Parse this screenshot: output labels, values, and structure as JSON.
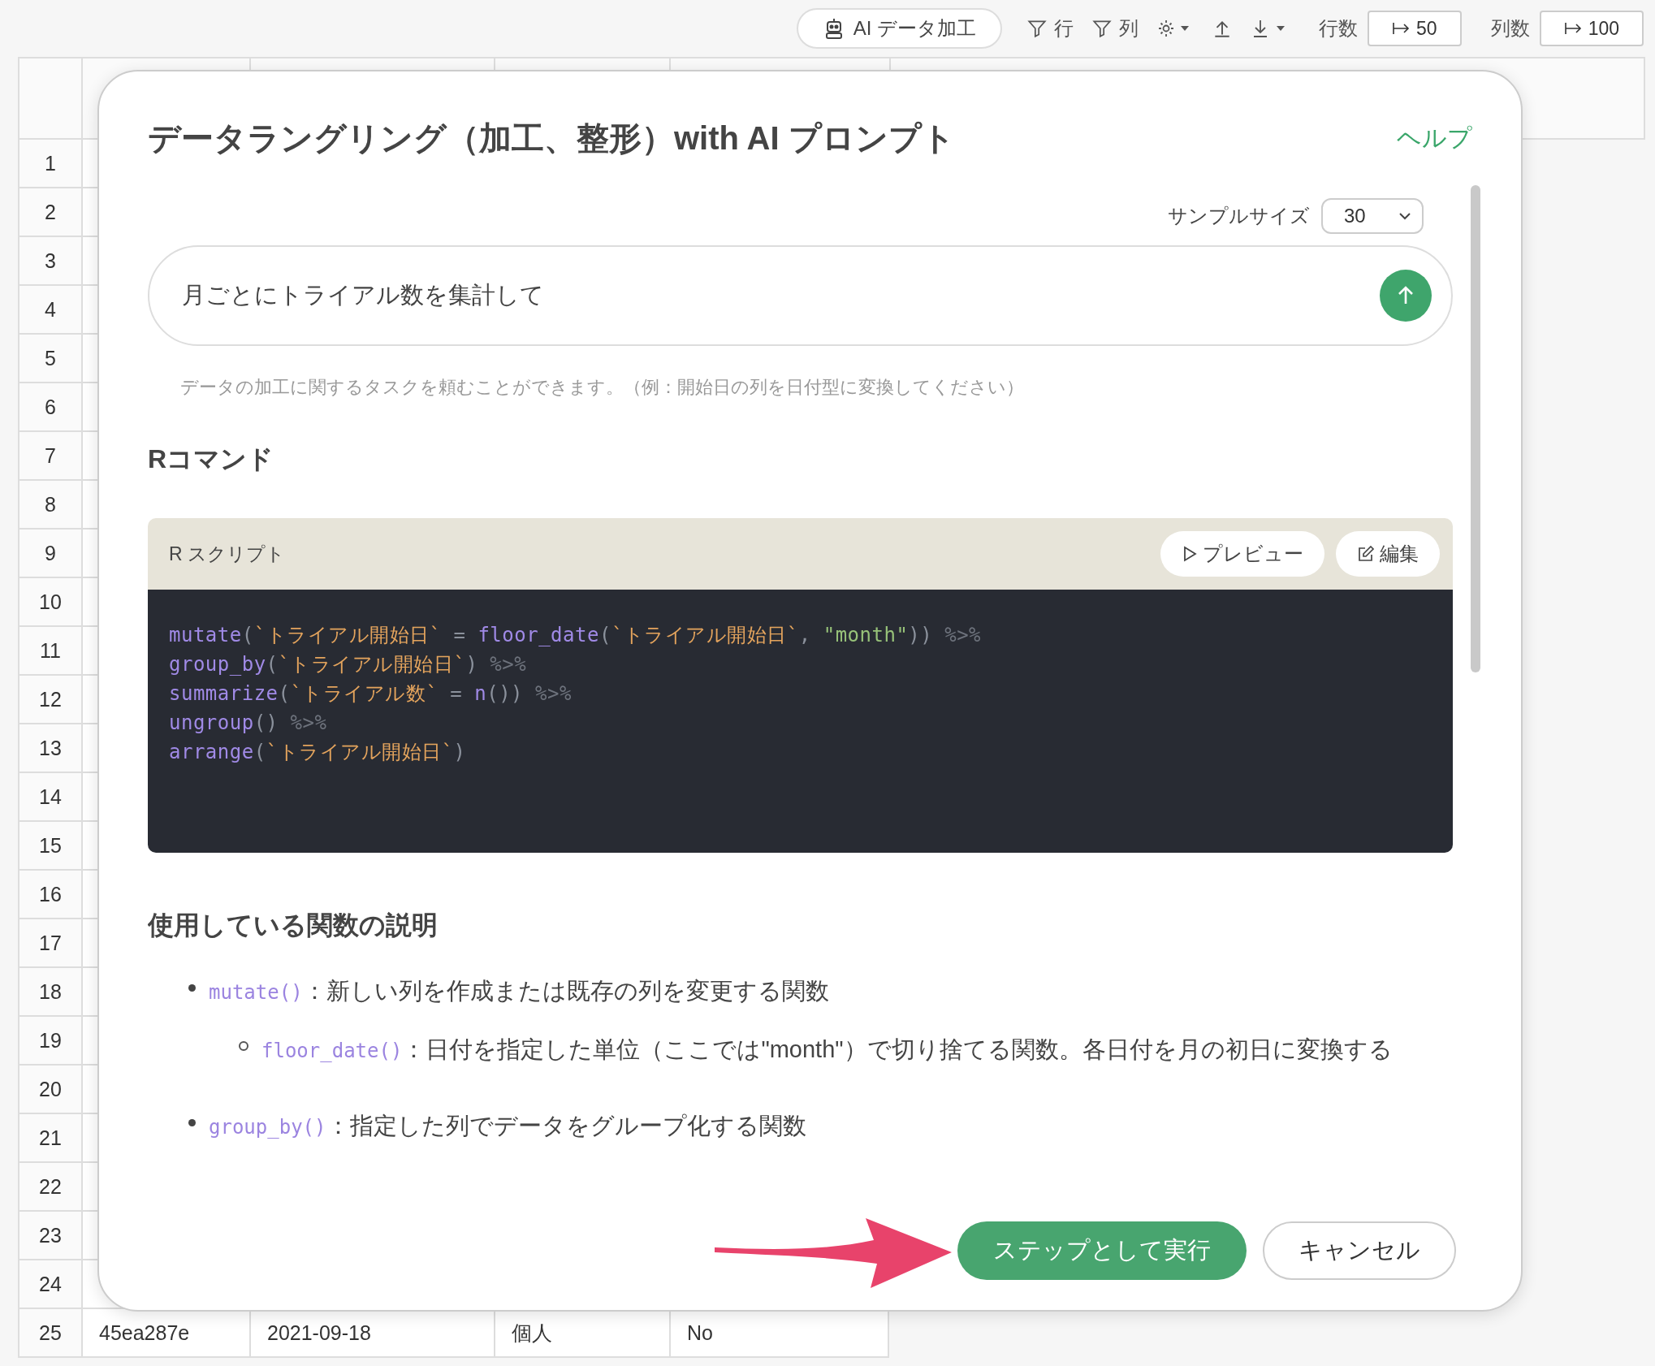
{
  "toolbar": {
    "ai_button": "AI データ加工",
    "row_filter": "行",
    "column_filter": "列",
    "row_count_label": "行数",
    "row_count": "50",
    "column_count_label": "列数",
    "column_count": "100"
  },
  "sheet": {
    "row_numbers": [
      "1",
      "2",
      "3",
      "4",
      "5",
      "6",
      "7",
      "8",
      "9",
      "10",
      "11",
      "12",
      "13",
      "14",
      "15",
      "16",
      "17",
      "18",
      "19",
      "20",
      "21",
      "22",
      "23",
      "24",
      "25"
    ],
    "last_row": [
      "45ea287e",
      "2021-09-18",
      "個人",
      "No"
    ]
  },
  "dialog": {
    "title": "データラングリング（加工、整形）with AI プロンプト",
    "help_link": "ヘルプ",
    "sample_size_label": "サンプルサイズ",
    "sample_size": "30",
    "prompt": "月ごとにトライアル数を集計して",
    "hint": "データの加工に関するタスクを頼むことができます。（例：開始日の列を日付型に変換してください）",
    "command_heading": "Rコマンド",
    "script_title": "R スクリプト",
    "preview_button": "プレビュー",
    "edit_button": "編集",
    "code_lines": [
      [
        {
          "kind": "fn",
          "text": "mutate"
        },
        {
          "kind": "punct",
          "text": "("
        },
        {
          "kind": "name",
          "text": "`トライアル開始日`"
        },
        {
          "kind": "punct",
          "text": " = "
        },
        {
          "kind": "fn",
          "text": "floor_date"
        },
        {
          "kind": "punct",
          "text": "("
        },
        {
          "kind": "name",
          "text": "`トライアル開始日`"
        },
        {
          "kind": "punct",
          "text": ", "
        },
        {
          "kind": "string",
          "text": "\"month\""
        },
        {
          "kind": "punct",
          "text": ")) "
        },
        {
          "kind": "pipe",
          "text": "%>%"
        }
      ],
      [
        {
          "kind": "fn",
          "text": "group_by"
        },
        {
          "kind": "punct",
          "text": "("
        },
        {
          "kind": "name",
          "text": "`トライアル開始日`"
        },
        {
          "kind": "punct",
          "text": ") "
        },
        {
          "kind": "pipe",
          "text": "%>%"
        }
      ],
      [
        {
          "kind": "fn",
          "text": "summarize"
        },
        {
          "kind": "punct",
          "text": "("
        },
        {
          "kind": "name",
          "text": "`トライアル数`"
        },
        {
          "kind": "punct",
          "text": " = "
        },
        {
          "kind": "fn",
          "text": "n"
        },
        {
          "kind": "punct",
          "text": "()) "
        },
        {
          "kind": "pipe",
          "text": "%>%"
        }
      ],
      [
        {
          "kind": "fn",
          "text": "ungroup"
        },
        {
          "kind": "punct",
          "text": "() "
        },
        {
          "kind": "pipe",
          "text": "%>%"
        }
      ],
      [
        {
          "kind": "fn",
          "text": "arrange"
        },
        {
          "kind": "punct",
          "text": "("
        },
        {
          "kind": "name",
          "text": "`トライアル開始日`"
        },
        {
          "kind": "punct",
          "text": ")"
        }
      ]
    ],
    "functions_heading": "使用している関数の説明",
    "separator": "：",
    "functions": [
      {
        "code": "mutate()",
        "text": "新しい列を作成または既存の列を変更する関数",
        "children": [
          {
            "code": "floor_date()",
            "text": "日付を指定した単位（ここでは\"month\"）で切り捨てる関数。各日付を月の初日に変換する"
          }
        ]
      },
      {
        "code": "group_by()",
        "text": "指定した列でデータをグループ化する関数"
      }
    ],
    "run_button": "ステップとして実行",
    "cancel_button": "キャンセル"
  }
}
